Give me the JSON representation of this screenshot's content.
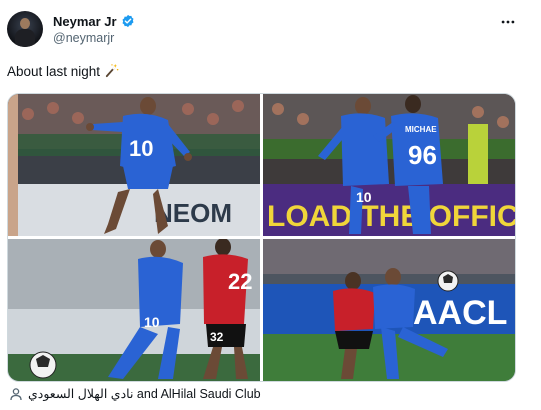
{
  "author": {
    "display_name": "Neymar Jr",
    "handle": "@neymarjr",
    "verified": true
  },
  "tweet": {
    "text": "About last night",
    "emoji_icon": "magic-wand-icon"
  },
  "media": {
    "photos": [
      {
        "name": "photo-1",
        "jersey_number": "10",
        "board_text": "NEOM"
      },
      {
        "name": "photo-2",
        "jersey_number_a": "10",
        "jersey_number_b": "96",
        "shirt_name_b": "MICHAE",
        "board_text": "LOAD THE OFFIC"
      },
      {
        "name": "photo-3",
        "jersey_number_a": "10",
        "jersey_number_b": "32",
        "opponent_number_top": "22"
      },
      {
        "name": "photo-4",
        "board_text": "AACL"
      }
    ]
  },
  "tagged": {
    "text": "نادي الهلال السعودي and AlHilal Saudi Club"
  },
  "colors": {
    "accent": "#1d9bf0",
    "hilal_blue": "#2a63d4",
    "opponent_red": "#c8202a",
    "secondary_text": "#536471"
  }
}
